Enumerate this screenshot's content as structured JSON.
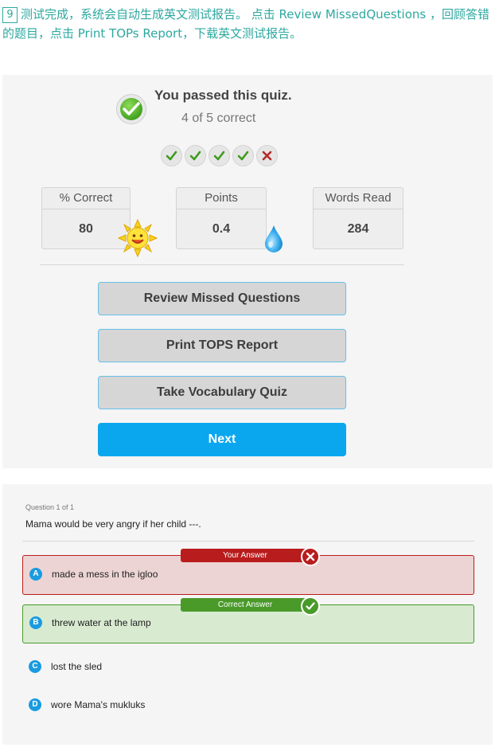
{
  "instruction": {
    "step": "9",
    "text": "测试完成，系统会自动生成英文测试报告。 点击 Review MissedQuestions ，回顾答错的题目，点击 Print TOPs Report，下载英文测试报告。"
  },
  "result": {
    "title": "You passed this quiz.",
    "subtitle": "4 of 5 correct",
    "marks": [
      "correct",
      "correct",
      "correct",
      "correct",
      "incorrect"
    ]
  },
  "stats": [
    {
      "label": "% Correct",
      "value": "80"
    },
    {
      "label": "Points",
      "value": "0.4"
    },
    {
      "label": "Words Read",
      "value": "284"
    }
  ],
  "buttons": {
    "review": "Review Missed Questions",
    "print": "Print TOPS Report",
    "vocab": "Take Vocabulary Quiz",
    "next": "Next"
  },
  "question": {
    "counter": "Question 1 of 1",
    "text": "Mama would be very angry if her child ---.",
    "your_answer_tag": "Your Answer",
    "correct_answer_tag": "Correct Answer",
    "options": [
      {
        "letter": "A",
        "text": "made a mess in the igloo",
        "status": "wrong"
      },
      {
        "letter": "B",
        "text": "threw water at the lamp",
        "status": "right"
      },
      {
        "letter": "C",
        "text": "lost the sled",
        "status": "plain"
      },
      {
        "letter": "D",
        "text": "wore Mama's mukluks",
        "status": "plain"
      }
    ]
  },
  "colors": {
    "accent_teal": "#2ea8a0",
    "next_blue": "#0aa7ef",
    "option_blue": "#1a9be0",
    "wrong_red": "#b91c1c",
    "right_green": "#4a9a2a"
  }
}
